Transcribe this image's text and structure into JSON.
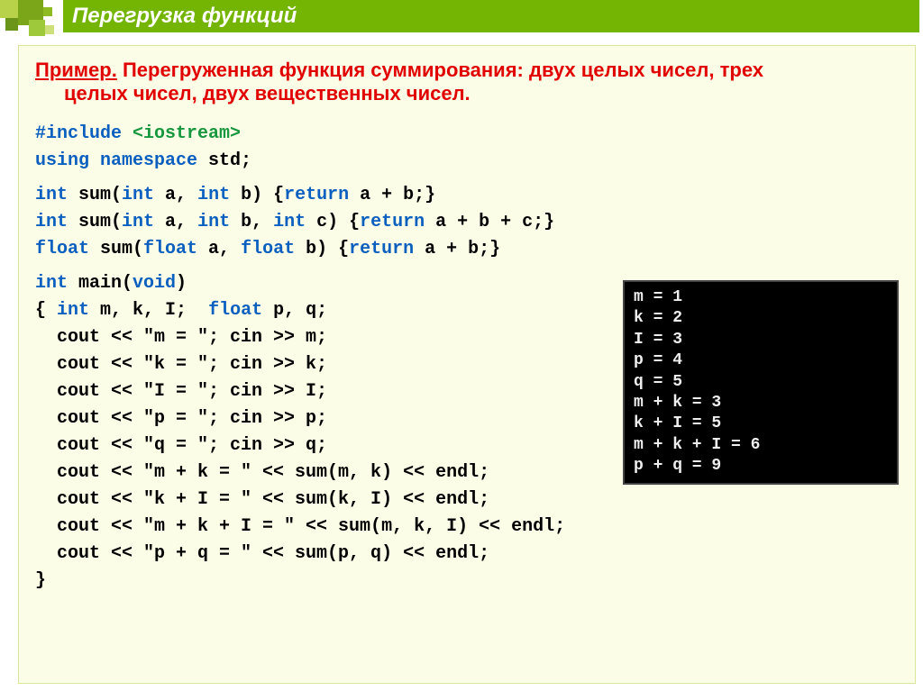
{
  "title": "Перегрузка функций",
  "example": {
    "prefix": "Пример.",
    "line1": " Перегруженная функция суммирования: двух целых чисел, трех",
    "line2": "целых чисел, двух вещественных чисел."
  },
  "code": {
    "include_kw": "#include ",
    "include_val": "<iostream>",
    "using_kw": "using namespace ",
    "using_val": "std;",
    "proto1": {
      "kw1": "int ",
      "name": "sum(",
      "kw2": "int ",
      "a": "a, ",
      "kw3": "int ",
      "b": "b) {",
      "kw4": "return ",
      "tail": "a + b;}"
    },
    "proto2": {
      "kw1": "int ",
      "name": "sum(",
      "kw2": "int ",
      "a": "a, ",
      "kw3": "int ",
      "b": "b, ",
      "kw4": "int ",
      "c": "c) {",
      "kw5": "return ",
      "tail": "a + b + c;}"
    },
    "proto3": {
      "kw1": "float ",
      "name": "sum(",
      "kw2": "float ",
      "a": "a, ",
      "kw3": "float ",
      "b": "b) {",
      "kw4": "return ",
      "tail": "a + b;}"
    },
    "main_kw1": "int ",
    "main_name": "main(",
    "main_kw2": "void",
    "main_close": ")",
    "l_brace": "{ ",
    "decl_kw1": "int ",
    "decl_1": "m, k, I;  ",
    "decl_kw2": "float ",
    "decl_2": "p, q;",
    "io1": "  cout << \"m = \"; cin >> m;",
    "io2": "  cout << \"k = \"; cin >> k;",
    "io3": "  cout << \"I = \"; cin >> I;",
    "io4": "  cout << \"p = \"; cin >> p;",
    "io5": "  cout << \"q = \"; cin >> q;",
    "s1": "  cout << \"m + k = \" << sum(m, k) << endl;",
    "s2": "  cout << \"k + I = \" << sum(k, I) << endl;",
    "s3": "  cout << \"m + k + I = \" << sum(m, k, I) << endl;",
    "s4": "  cout << \"p + q = \" << sum(p, q) << endl;",
    "r_brace": "}"
  },
  "console": {
    "l1": "m = 1",
    "l2": "k = 2",
    "l3": "I = 3",
    "l4": "p = 4",
    "l5": "q = 5",
    "l6": "m + k = 3",
    "l7": "k + I = 5",
    "l8": "m + k + I = 6",
    "l9": "p + q = 9"
  }
}
